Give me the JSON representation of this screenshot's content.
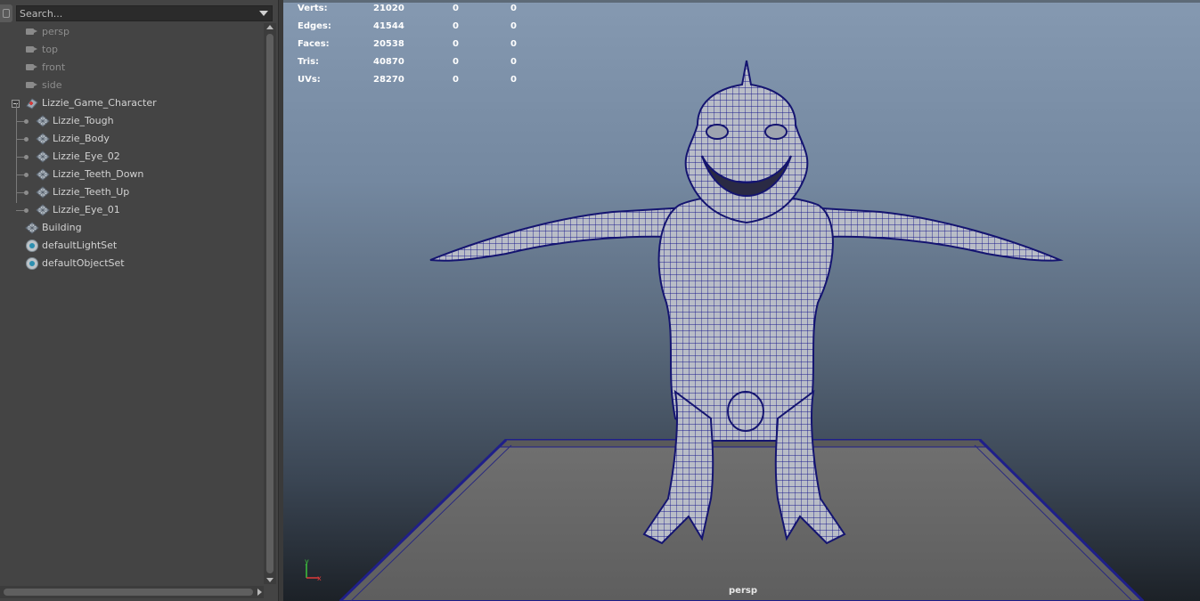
{
  "outliner": {
    "search_placeholder": "Search...",
    "items": [
      {
        "label": "persp",
        "type": "camera"
      },
      {
        "label": "top",
        "type": "camera"
      },
      {
        "label": "front",
        "type": "camera"
      },
      {
        "label": "side",
        "type": "camera"
      },
      {
        "label": "Lizzie_Game_Character",
        "type": "group",
        "expanded": true
      },
      {
        "label": "Lizzie_Tough",
        "type": "mesh"
      },
      {
        "label": "Lizzie_Body",
        "type": "mesh"
      },
      {
        "label": "Lizzie_Eye_02",
        "type": "mesh"
      },
      {
        "label": "Lizzie_Teeth_Down",
        "type": "mesh"
      },
      {
        "label": "Lizzie_Teeth_Up",
        "type": "mesh"
      },
      {
        "label": "Lizzie_Eye_01",
        "type": "mesh"
      },
      {
        "label": "Building",
        "type": "mesh"
      },
      {
        "label": "defaultLightSet",
        "type": "set"
      },
      {
        "label": "defaultObjectSet",
        "type": "set"
      }
    ]
  },
  "viewport": {
    "stats": [
      {
        "name": "Verts:",
        "total": "21020",
        "selected": "0",
        "components": "0"
      },
      {
        "name": "Edges:",
        "total": "41544",
        "selected": "0",
        "components": "0"
      },
      {
        "name": "Faces:",
        "total": "20538",
        "selected": "0",
        "components": "0"
      },
      {
        "name": "Tris:",
        "total": "40870",
        "selected": "0",
        "components": "0"
      },
      {
        "name": "UVs:",
        "total": "28270",
        "selected": "0",
        "components": "0"
      }
    ],
    "camera_name": "persp",
    "axis": {
      "y": "y",
      "x": "x"
    },
    "colors": {
      "wireframe": "#1a1a8c",
      "mesh": "#b9bdc7",
      "ground": "#6b6b6b"
    }
  }
}
